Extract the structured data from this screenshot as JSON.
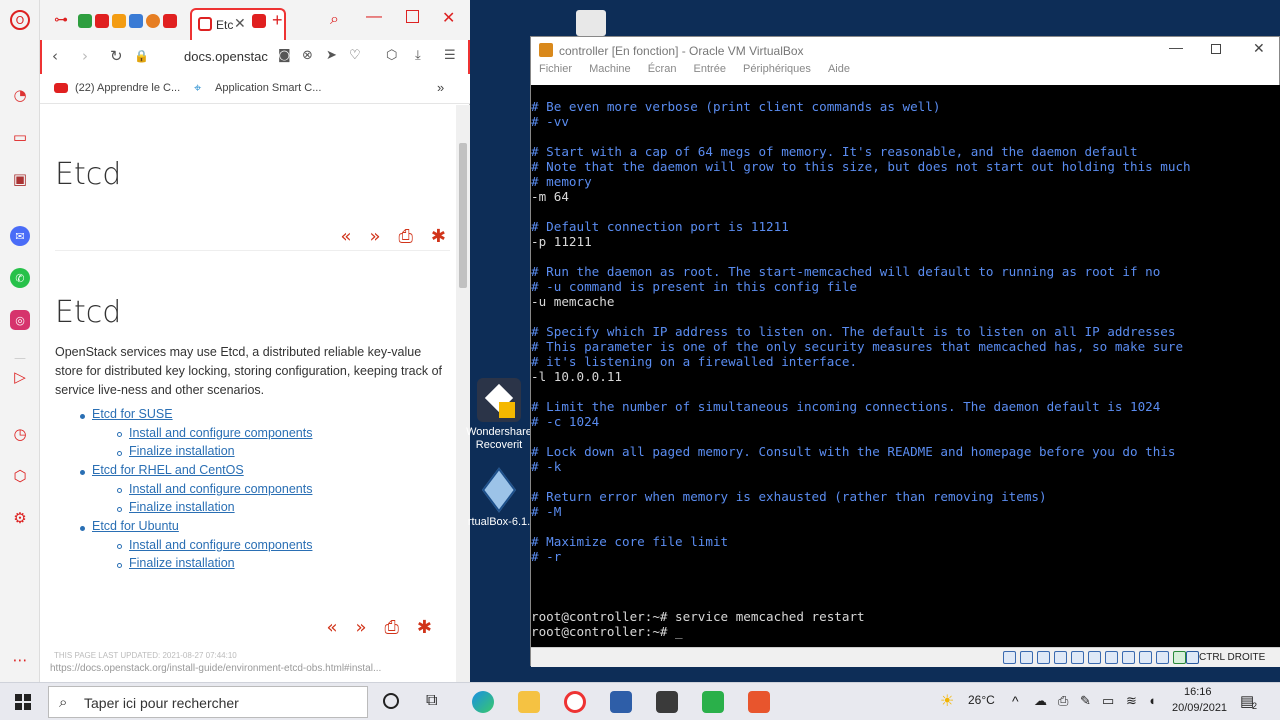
{
  "browser": {
    "url": "docs.openstac",
    "active_tab_label": "Etc",
    "bookmarks": [
      "(22) Apprendre le C...",
      "Application Smart C..."
    ],
    "bookmarks_more": "»"
  },
  "doc": {
    "title_top": "Etcd",
    "title_main": "Etcd",
    "description": "OpenStack services may use Etcd, a distributed reliable key-value store for distributed key locking, storing configuration, keeping track of service live-ness and other scenarios.",
    "toc": [
      {
        "label": "Etcd for SUSE",
        "children": [
          "Install and configure components",
          "Finalize installation"
        ]
      },
      {
        "label": "Etcd for RHEL and CentOS",
        "children": [
          "Install and configure components",
          "Finalize installation"
        ]
      },
      {
        "label": "Etcd for Ubuntu",
        "children": [
          "Install and configure components",
          "Finalize installation"
        ]
      }
    ],
    "last_updated": "THIS PAGE LAST UPDATED: 2021-08-27 07:44:10",
    "footer_url": "https://docs.openstack.org/install-guide/environment-etcd-obs.html#instal..."
  },
  "desktop_icons": {
    "recoverit": "Wondershare Recoverit",
    "virtualbox": "rtualBox-6.1."
  },
  "vbox": {
    "title": "controller [En fonction] - Oracle VM VirtualBox",
    "menu": [
      "Fichier",
      "Machine",
      "Écran",
      "Entrée",
      "Périphériques",
      "Aide"
    ],
    "host_key": "CTRL DROITE",
    "console_lines": [
      {
        "t": "# Be even more verbose (print client commands as well)",
        "c": "comment"
      },
      {
        "t": "# -vv",
        "c": "comment"
      },
      {
        "t": "",
        "c": "cmd"
      },
      {
        "t": "# Start with a cap of 64 megs of memory. It's reasonable, and the daemon default",
        "c": "comment"
      },
      {
        "t": "# Note that the daemon will grow to this size, but does not start out holding this much",
        "c": "comment"
      },
      {
        "t": "# memory",
        "c": "comment"
      },
      {
        "t": "-m 64",
        "c": "cmd"
      },
      {
        "t": "",
        "c": "cmd"
      },
      {
        "t": "# Default connection port is 11211",
        "c": "comment"
      },
      {
        "t": "-p 11211",
        "c": "cmd"
      },
      {
        "t": "",
        "c": "cmd"
      },
      {
        "t": "# Run the daemon as root. The start-memcached will default to running as root if no",
        "c": "comment"
      },
      {
        "t": "# -u command is present in this config file",
        "c": "comment"
      },
      {
        "t": "-u memcache",
        "c": "cmd"
      },
      {
        "t": "",
        "c": "cmd"
      },
      {
        "t": "# Specify which IP address to listen on. The default is to listen on all IP addresses",
        "c": "comment"
      },
      {
        "t": "# This parameter is one of the only security measures that memcached has, so make sure",
        "c": "comment"
      },
      {
        "t": "# it's listening on a firewalled interface.",
        "c": "comment"
      },
      {
        "t": "-l 10.0.0.11",
        "c": "cmd"
      },
      {
        "t": "",
        "c": "cmd"
      },
      {
        "t": "# Limit the number of simultaneous incoming connections. The daemon default is 1024",
        "c": "comment"
      },
      {
        "t": "# -c 1024",
        "c": "comment"
      },
      {
        "t": "",
        "c": "cmd"
      },
      {
        "t": "# Lock down all paged memory. Consult with the README and homepage before you do this",
        "c": "comment"
      },
      {
        "t": "# -k",
        "c": "comment"
      },
      {
        "t": "",
        "c": "cmd"
      },
      {
        "t": "# Return error when memory is exhausted (rather than removing items)",
        "c": "comment"
      },
      {
        "t": "# -M",
        "c": "comment"
      },
      {
        "t": "",
        "c": "cmd"
      },
      {
        "t": "# Maximize core file limit",
        "c": "comment"
      },
      {
        "t": "# -r",
        "c": "comment"
      },
      {
        "t": "",
        "c": "cmd"
      },
      {
        "t": "",
        "c": "cmd"
      },
      {
        "t": "",
        "c": "cmd"
      },
      {
        "t": "root@controller:~# service memcached restart",
        "c": "cmd"
      },
      {
        "t": "root@controller:~# _",
        "c": "cmd"
      }
    ]
  },
  "taskbar": {
    "search_placeholder": "Taper ici pour rechercher",
    "temperature": "26°C",
    "time": "16:16",
    "date": "20/09/2021",
    "notifications": "2"
  },
  "colors": {
    "opera_red": "#e33",
    "console_comment": "#5a8cf0",
    "doc_link": "#2a6fb4",
    "doc_accent": "#d1341a"
  }
}
